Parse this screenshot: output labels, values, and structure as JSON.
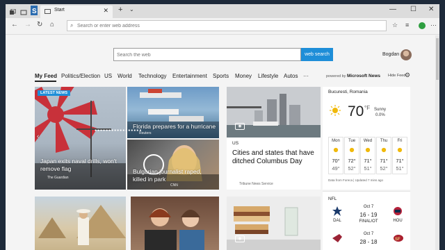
{
  "browser": {
    "tab_title": "Start",
    "tab_close": "✕",
    "new_tab": "+",
    "tab_menu": "⌄",
    "window_controls": [
      "—",
      "☐",
      "✕"
    ],
    "address_placeholder": "Search or enter web address",
    "nav_icons": [
      "back-arrow-icon",
      "forward-arrow-icon",
      "refresh-icon",
      "home-icon"
    ],
    "toolbar_icons": [
      "reading-view-icon",
      "favorite-star-icon",
      "hub-icon",
      "extension-icon",
      "more-icon"
    ]
  },
  "search": {
    "placeholder": "Search the web",
    "button_label": "web search"
  },
  "user": {
    "name": "Bogdan"
  },
  "feed_nav": {
    "items": [
      "My Feed",
      "Politics/Election",
      "US",
      "World",
      "Technology",
      "Entertainment",
      "Sports",
      "Money",
      "Lifestyle",
      "Autos",
      "···"
    ],
    "powered_prefix": "powered by",
    "powered_brand": "Microsoft News",
    "hide_feed": "Hide Feed"
  },
  "cards": {
    "main": {
      "badge": "LATEST NEWS",
      "headline": "Japan exits naval drills, won't remove flag",
      "source": "The Guardian"
    },
    "florida": {
      "headline": "Florida prepares for a hurricane",
      "source": "Reuters"
    },
    "bulgarian": {
      "headline": "Bulgarian journalist raped, killed in park",
      "source": "CNN"
    },
    "columbus": {
      "category": "US",
      "headline": "Cities and states that have ditched Columbus Day",
      "source": "Tribune News Service"
    }
  },
  "weather": {
    "location": "Bucuresti, Romania",
    "temp": "70",
    "unit": "°F",
    "condition": "Sunny",
    "precip": "0.0%",
    "days": [
      {
        "name": "Mon",
        "hi": "70°",
        "lo": "49°"
      },
      {
        "name": "Tue",
        "hi": "72°",
        "lo": "52°"
      },
      {
        "name": "Wed",
        "hi": "71°",
        "lo": "51°"
      },
      {
        "name": "Thu",
        "hi": "71°",
        "lo": "52°"
      },
      {
        "name": "Fri",
        "hi": "71°",
        "lo": "51°"
      }
    ],
    "footer": "Data from Foreca | Updated 7 mins ago"
  },
  "nfl": {
    "title": "NFL",
    "games": [
      {
        "away": "DAL",
        "home": "HOU",
        "date": "Oct 7",
        "score": "16 - 19",
        "status": "FINAL/OT"
      },
      {
        "away": "",
        "home": "",
        "date": "Oct 7",
        "score": "28 - 18",
        "status": ""
      }
    ]
  },
  "colors": {
    "accent": "#1e8ed8",
    "chrome": "#dcdcdc"
  }
}
